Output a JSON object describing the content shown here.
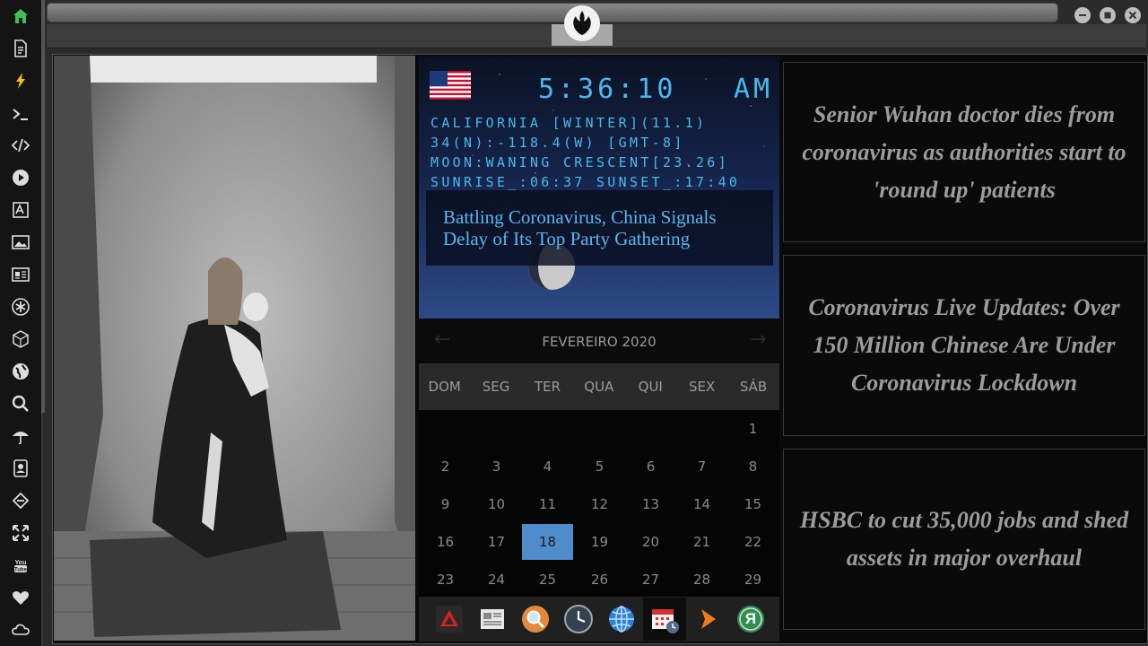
{
  "clock": {
    "time": "5:36:10",
    "ampm": "AM",
    "line1": "CALIFORNIA [WINTER](11.1)",
    "line2": "34(N):-118.4(W) [GMT-8]",
    "line3": "MOON:WANING CRESCENT[23.26]",
    "line4": "SUNRISE_:06:37 SUNSET_:17:40",
    "headline": "Battling Coronavirus, China Signals Delay of Its Top Party Gathering"
  },
  "calendar": {
    "month": "FEVEREIRO 2020",
    "prev": "←",
    "next": "→",
    "weekdays": [
      "DOM",
      "SEG",
      "TER",
      "QUA",
      "QUI",
      "SEX",
      "SÁB"
    ],
    "days": [
      "1",
      "2",
      "3",
      "4",
      "5",
      "6",
      "7",
      "8",
      "9",
      "10",
      "11",
      "12",
      "13",
      "14",
      "15",
      "16",
      "17",
      "18",
      "19",
      "20",
      "21",
      "22",
      "23",
      "24",
      "25",
      "26",
      "27",
      "28",
      "29"
    ],
    "today": "18"
  },
  "news": [
    "Senior Wuhan doctor dies from coronavirus as authorities start to 'round up' patients",
    "Coronavirus Live Updates: Over 150 Million Chinese Are Under Coronavirus Lockdown",
    "HSBC to cut 35,000 jobs and shed assets in major overhaul"
  ],
  "sidebar": {
    "icons": [
      "home-icon",
      "document-icon",
      "lightning-icon",
      "terminal-icon",
      "code-icon",
      "play-icon",
      "translate-icon",
      "image-icon",
      "newspaper-icon",
      "asterisk-icon",
      "cube-icon",
      "globe-icon",
      "search-icon",
      "umbrella-icon",
      "contacts-icon",
      "link-icon",
      "expand-icon",
      "youtube-icon",
      "heart-icon",
      "cloud-icon"
    ],
    "youtube_label": "You Tube"
  },
  "dock": {
    "icons": [
      "red-triangle-app-icon",
      "news-app-icon",
      "search-app-icon",
      "clock-app-icon",
      "globe-app-icon",
      "calendar-app-icon",
      "arrow-app-icon",
      "yandex-app-icon"
    ],
    "yandex_label": "Я"
  },
  "colors": {
    "accent": "#4f8ccc",
    "lcd": "#49b8ea",
    "home": "#3fbf5a",
    "lightning": "#f0c020"
  }
}
